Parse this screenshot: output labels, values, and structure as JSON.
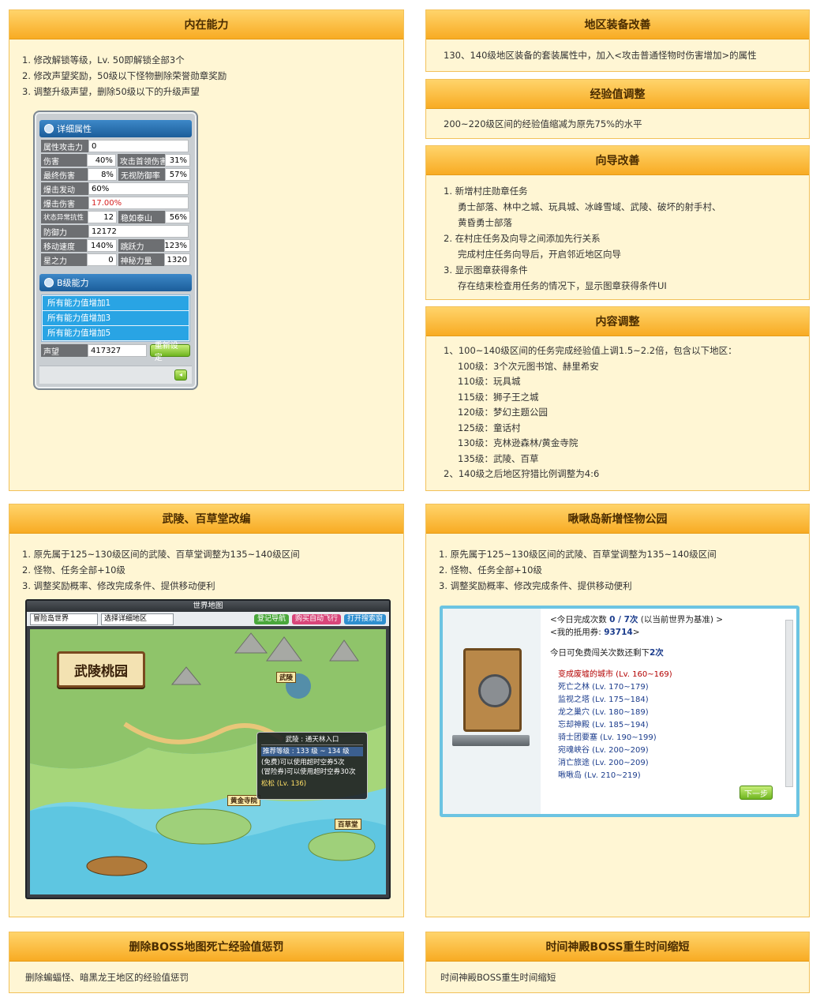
{
  "inner_ability": {
    "title": "内在能力",
    "items": [
      "1. 修改解锁等级，Lv. 50即解锁全部3个",
      "2. 修改声望奖励，50级以下怪物删除荣誉勋章奖励",
      "3. 调整升级声望，删除50级以下的升级声望"
    ],
    "stats_window": {
      "header": "详细属性",
      "rows": [
        {
          "label": "属性攻击力",
          "value": "0"
        },
        {
          "label": "伤害",
          "value": "40%",
          "label2": "攻击首领伤害",
          "value2": "31%"
        },
        {
          "label": "最终伤害",
          "value": "8%",
          "label2": "无视防御率",
          "value2": "57%"
        },
        {
          "label": "爆击发动",
          "value": "60%"
        },
        {
          "label": "爆击伤害",
          "value": "17.00%"
        },
        {
          "label": "状态异常抗性",
          "value": "12",
          "label2": "稳如泰山",
          "value2": "56%"
        },
        {
          "label": "防御力",
          "value": "12172"
        },
        {
          "label": "移动速度",
          "value": "140%",
          "label2": "跳跃力",
          "value2": "123%"
        },
        {
          "label": "星之力",
          "value": "0",
          "label2": "神秘力量",
          "value2": "1320"
        }
      ],
      "ability_header": "B级能力",
      "ability_items": [
        "所有能力值增加1",
        "所有能力值增加3",
        "所有能力值增加5"
      ],
      "fame_label": "声望",
      "fame_value": "417327",
      "reset_button": "重新设定"
    }
  },
  "region_equip": {
    "title": "地区装备改善",
    "text": "130、140级地区装备的套装属性中，加入<攻击普通怪物时伤害增加>的属性"
  },
  "exp_adjust": {
    "title": "经验值调整",
    "text": "200~220级区间的经验值缩减为原先75%的水平"
  },
  "guide": {
    "title": "向导改善",
    "items": [
      {
        "main": "1.   新增村庄勋章任务",
        "subs": [
          "勇士部落、林中之城、玩具城、冰峰雪域、武陵、破坏的射手村、",
          "黄昏勇士部落"
        ]
      },
      {
        "main": "2.   在村庄任务及向导之间添加先行关系",
        "subs": [
          "完成村庄任务向导后，开启邻近地区向导"
        ]
      },
      {
        "main": "3.   显示图章获得条件",
        "subs": [
          "存在结束检查用任务的情况下，显示图章获得条件UI"
        ]
      }
    ]
  },
  "content_adjust": {
    "title": "内容调整",
    "line1": "1、100~140级区间的任务完成经验值上调1.5~2.2倍，包含以下地区：",
    "regions": [
      "100级：3个次元图书馆、赫里希安",
      "110级：玩具城",
      "115级：狮子王之城",
      "120级：梦幻主题公园",
      "125级：童话村",
      "130级：克林逊森林/黄金寺院",
      "135级：武陵、百草"
    ],
    "line2": "2、140级之后地区狩猎比例调整为4:6"
  },
  "wuling": {
    "title": "武陵、百草堂改编",
    "items": [
      "1. 原先属于125~130级区间的武陵、百草堂调整为135~140级区间",
      "2. 怪物、任务全部+10级",
      "3. 调整奖励概率、修改完成条件、提供移动便利"
    ],
    "map": {
      "window_title": "世界地图",
      "world_select": "冒险岛世界",
      "region_select": "选择详细地区",
      "chip1": "登记导航",
      "chip2": "购买自动飞行",
      "chip3": "打开搜索窗",
      "sign": "武陵桃园",
      "tag_wuling": "武陵",
      "tag_golden": "黄金寺院",
      "tag_baicao": "百草堂",
      "tooltip_title": "武陵 : 通天林入口",
      "tooltip_level": "推荐等级 : 133 级 ~ 134 级",
      "tooltip_line1": "(免费)可以使用超时空券5次",
      "tooltip_line2": "(冒险券)可以使用超时空券30次",
      "tooltip_npc": "松松 (Lv. 136)"
    }
  },
  "monster_park": {
    "title": "啾啾岛新增怪物公园",
    "items": [
      "1. 原先属于125~130级区间的武陵、百草堂调整为135~140级区间",
      "2. 怪物、任务全部+10级",
      "3. 调整奖励概率、修改完成条件、提供移动便利"
    ],
    "window": {
      "today_label": "<今日完成次数",
      "today_value": "0 / 7次",
      "today_suffix": "(以当前世界为基准) >",
      "ticket_label": "<我的抵用券:",
      "ticket_value": "93714",
      "ticket_suffix": ">",
      "free_text": "今日可免费闯关次数还剩下",
      "free_value": "2次",
      "dungeons": [
        "变成废墟的城市 (Lv. 160~169)",
        "死亡之林 (Lv. 170~179)",
        "监视之塔 (Lv. 175~184)",
        "龙之巢穴 (Lv. 180~189)",
        "忘却神殿 (Lv. 185~194)",
        "骑士团要塞 (Lv. 190~199)",
        "宛魂峡谷 (Lv. 200~209)",
        "消亡旅途 (Lv. 200~209)",
        "啾啾岛 (Lv. 210~219)"
      ],
      "next_button": "下一步"
    }
  },
  "boss_death": {
    "title": "删除BOSS地图死亡经验值惩罚",
    "text": "删除蝙蝠怪、暗黑龙王地区的经验值惩罚"
  },
  "time_temple": {
    "title": "时间神殿BOSS重生时间缩短",
    "text": "时间神殿BOSS重生时间缩短"
  }
}
